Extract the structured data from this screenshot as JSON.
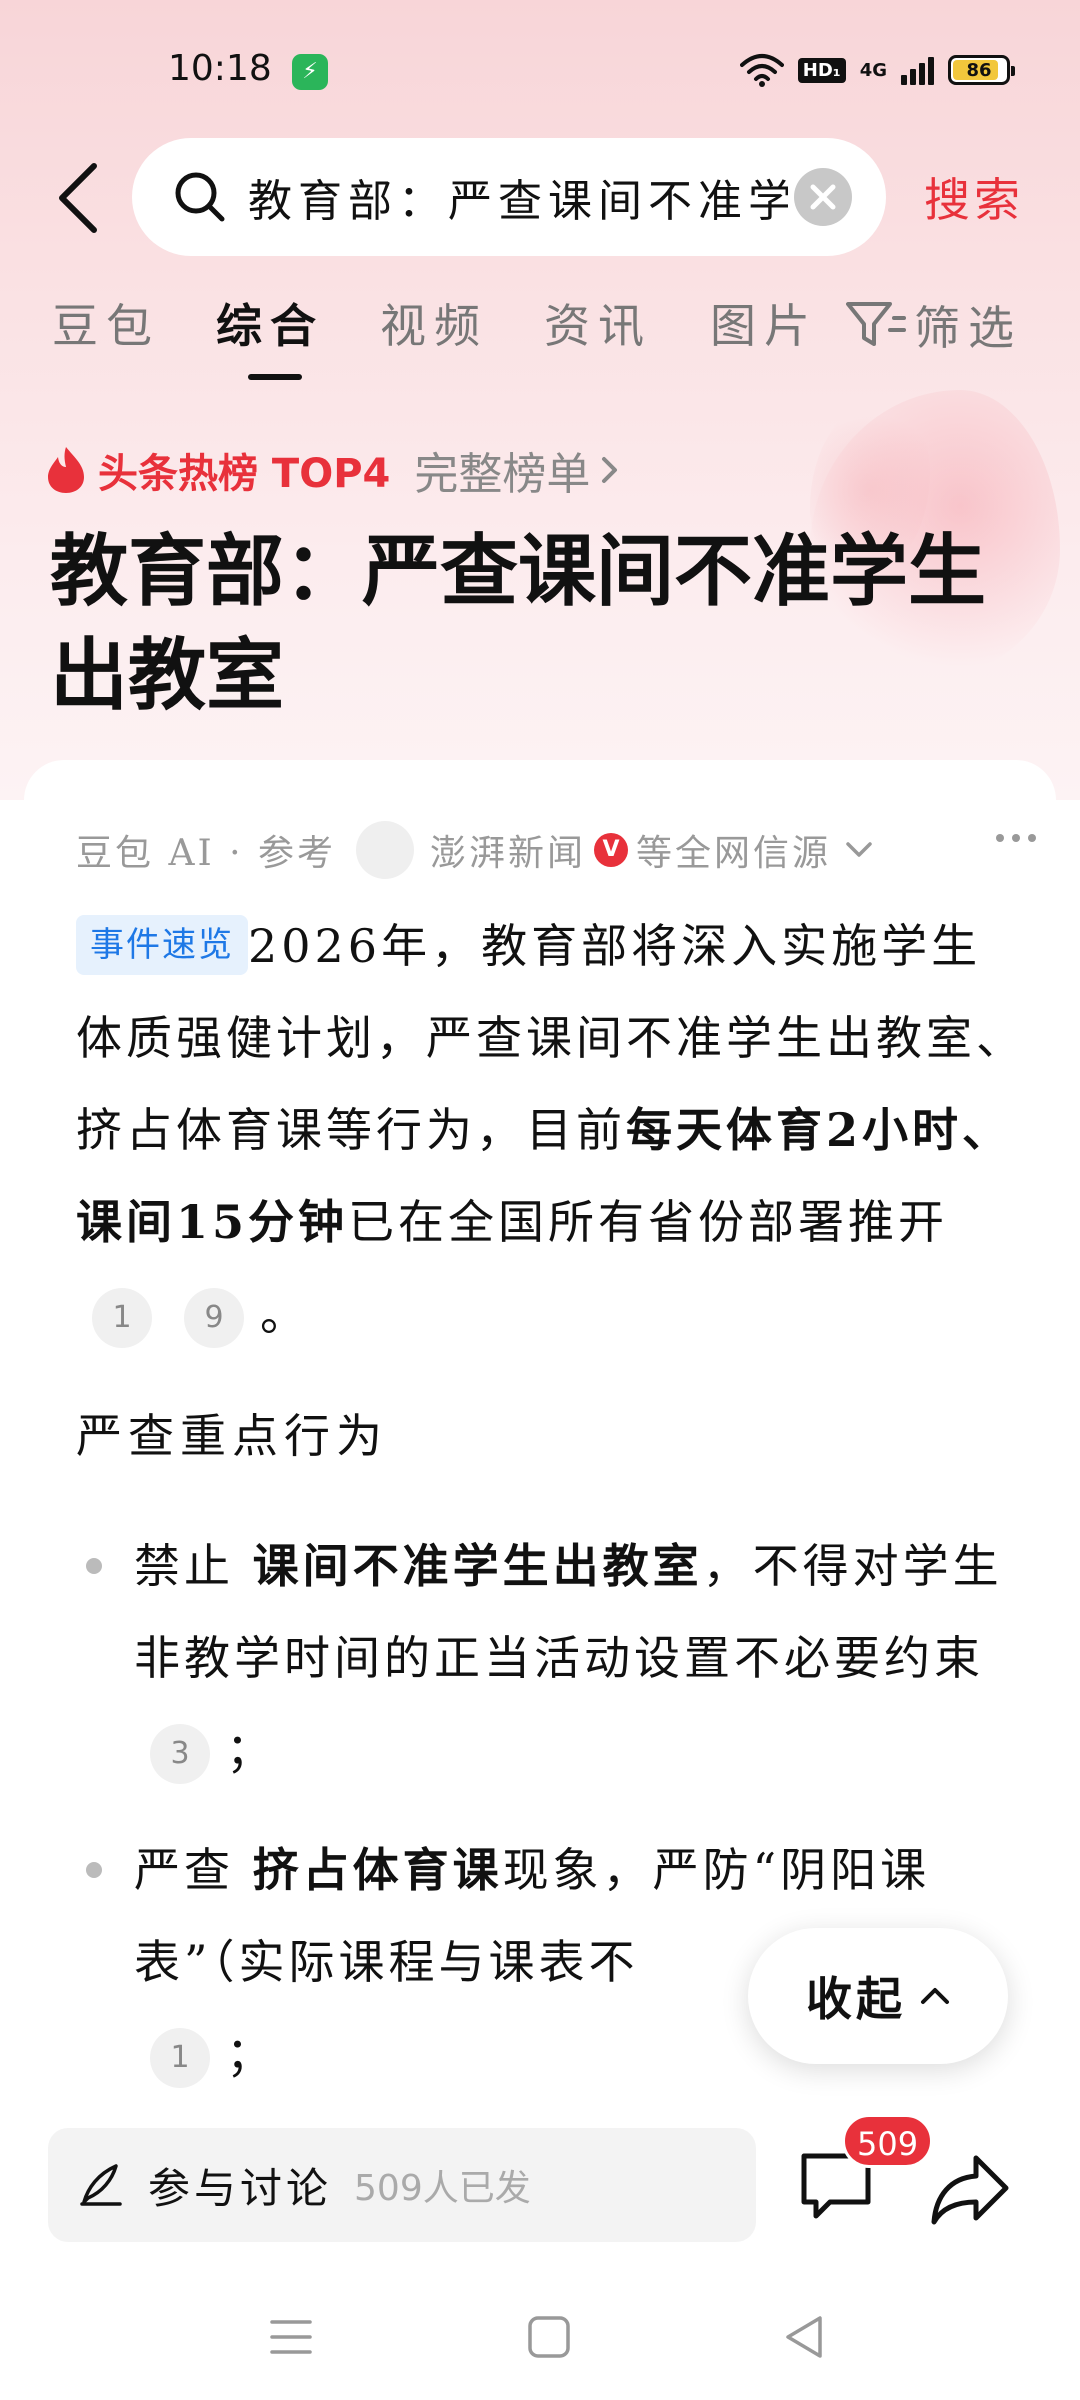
{
  "status_bar": {
    "time": "10:18",
    "hd": "HD₁",
    "network": "4G",
    "battery": "86",
    "battery_level": 0.86
  },
  "search": {
    "query": "教育部：严查课间不准学生出教室",
    "button_label": "搜索"
  },
  "tabs": [
    {
      "label": "豆包",
      "active": false
    },
    {
      "label": "综合",
      "active": true
    },
    {
      "label": "视频",
      "active": false
    },
    {
      "label": "资讯",
      "active": false
    },
    {
      "label": "图片",
      "active": false
    },
    {
      "label": "筛选",
      "active": false
    }
  ],
  "hot": {
    "label": "头条热榜 TOP4",
    "full_list": "完整榜单"
  },
  "headline": "教育部：严查课间不准学生出教室",
  "card": {
    "source_prefix": "豆包 AI · 参考",
    "source_name": "澎湃新闻",
    "verified_mark": "V",
    "source_suffix": "等全网信源",
    "summary_tag": "事件速览",
    "summary_p1": "2026年，教育部将深入实施学生体质强健计划，严查课间不准学生出教室、挤占体育课等行为，目前",
    "summary_bold": "每天体育2小时、课间15分钟",
    "summary_p2": "已在全国所有省份部署推开",
    "summary_cites": [
      "1",
      "9"
    ],
    "summary_end": "。",
    "section_title": "严查重点行为",
    "bullets": [
      {
        "prefix": "禁止",
        "bold": "课间不准学生出教室",
        "text": "，不得对学生非教学时间的正当活动设置不必要约束",
        "cite": "3",
        "end": "；"
      },
      {
        "prefix": "严查",
        "bold": "挤占体育课",
        "text": "现象，严防“阴阳课表”（实际课程与课表不",
        "cite": "1",
        "end": "；"
      }
    ],
    "collapse_label": "收起"
  },
  "bottom": {
    "discuss_label": "参与讨论",
    "discuss_count": "509人已发",
    "comment_badge": "509"
  },
  "colors": {
    "accent_red": "#e8313b",
    "tag_blue": "#1e78e6"
  }
}
